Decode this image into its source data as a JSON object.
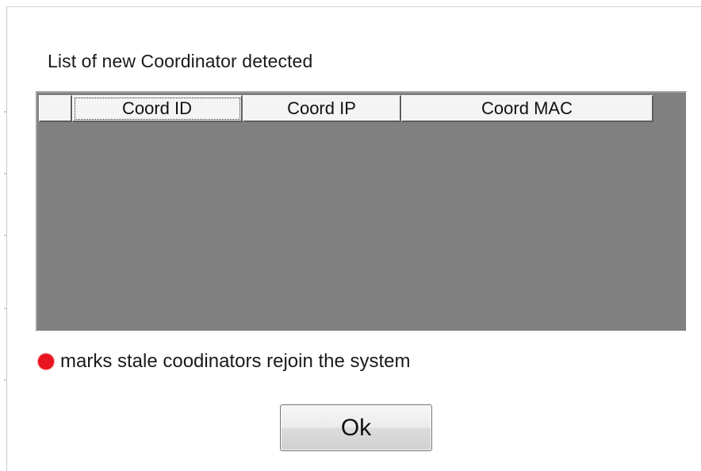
{
  "dialog": {
    "title": "List of new Coordinator detected"
  },
  "table": {
    "columns": [
      {
        "label": ""
      },
      {
        "label": "Coord ID"
      },
      {
        "label": "Coord IP"
      },
      {
        "label": "Coord MAC"
      }
    ],
    "rows": []
  },
  "legend": {
    "marker_color": "#e8141e",
    "text": "marks stale coodinators rejoin the system"
  },
  "buttons": {
    "ok_label": "Ok"
  },
  "colors": {
    "grid_background": "#808080",
    "window_background": "#ffffff"
  }
}
